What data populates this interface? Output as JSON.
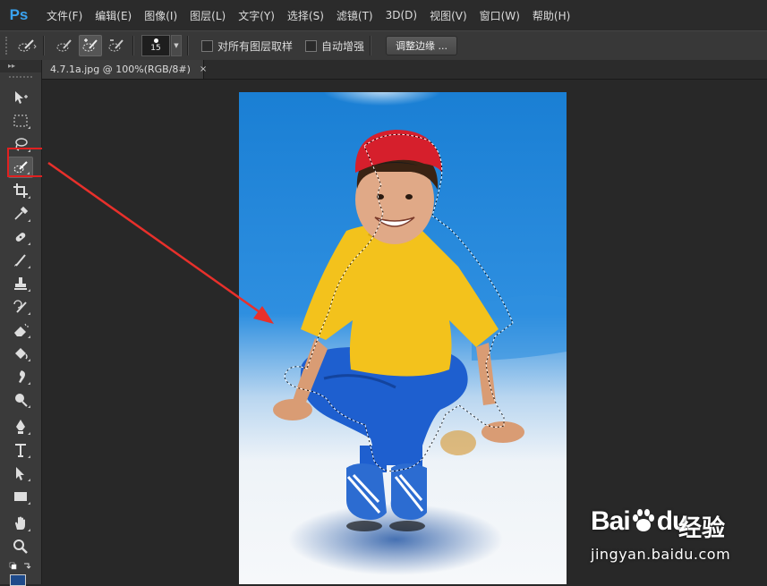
{
  "app": {
    "logo": "Ps",
    "accent": "#3aa3f1"
  },
  "menu": [
    {
      "label": "文件(F)"
    },
    {
      "label": "编辑(E)"
    },
    {
      "label": "图像(I)"
    },
    {
      "label": "图层(L)"
    },
    {
      "label": "文字(Y)"
    },
    {
      "label": "选择(S)"
    },
    {
      "label": "滤镜(T)"
    },
    {
      "label": "3D(D)"
    },
    {
      "label": "视图(V)"
    },
    {
      "label": "窗口(W)"
    },
    {
      "label": "帮助(H)"
    }
  ],
  "options": {
    "brush_size": "15",
    "sample_all_layers": "对所有图层取样",
    "auto_enhance": "自动增强",
    "refine_edge": "调整边缘 ..."
  },
  "document": {
    "tab_title": "4.7.1a.jpg @ 100%(RGB/8#)",
    "close": "×"
  },
  "toolbox": {
    "header": "▸▸",
    "active_tool": "quick-selection-tool",
    "highlight_color": "#e02020"
  },
  "colors": {
    "foreground": "#1e4a8a"
  },
  "watermark": {
    "logo_left": "Bai",
    "logo_right": "du",
    "brand": "经验",
    "url": "jingyan.baidu.com"
  }
}
